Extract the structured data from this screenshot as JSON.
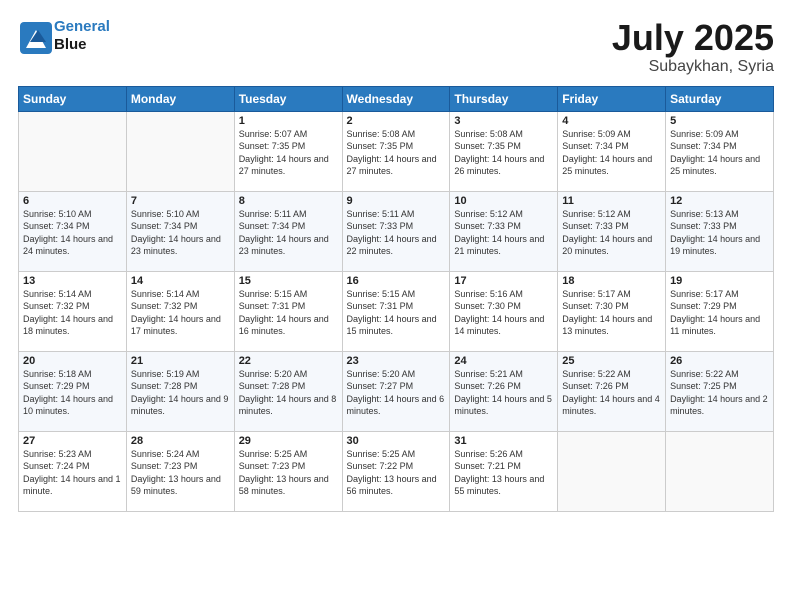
{
  "logo": {
    "line1": "General",
    "line2": "Blue"
  },
  "title": "July 2025",
  "subtitle": "Subaykhan, Syria",
  "header_days": [
    "Sunday",
    "Monday",
    "Tuesday",
    "Wednesday",
    "Thursday",
    "Friday",
    "Saturday"
  ],
  "weeks": [
    [
      {
        "day": "",
        "info": ""
      },
      {
        "day": "",
        "info": ""
      },
      {
        "day": "1",
        "sunrise": "5:07 AM",
        "sunset": "7:35 PM",
        "daylight": "14 hours and 27 minutes."
      },
      {
        "day": "2",
        "sunrise": "5:08 AM",
        "sunset": "7:35 PM",
        "daylight": "14 hours and 27 minutes."
      },
      {
        "day": "3",
        "sunrise": "5:08 AM",
        "sunset": "7:35 PM",
        "daylight": "14 hours and 26 minutes."
      },
      {
        "day": "4",
        "sunrise": "5:09 AM",
        "sunset": "7:34 PM",
        "daylight": "14 hours and 25 minutes."
      },
      {
        "day": "5",
        "sunrise": "5:09 AM",
        "sunset": "7:34 PM",
        "daylight": "14 hours and 25 minutes."
      }
    ],
    [
      {
        "day": "6",
        "sunrise": "5:10 AM",
        "sunset": "7:34 PM",
        "daylight": "14 hours and 24 minutes."
      },
      {
        "day": "7",
        "sunrise": "5:10 AM",
        "sunset": "7:34 PM",
        "daylight": "14 hours and 23 minutes."
      },
      {
        "day": "8",
        "sunrise": "5:11 AM",
        "sunset": "7:34 PM",
        "daylight": "14 hours and 23 minutes."
      },
      {
        "day": "9",
        "sunrise": "5:11 AM",
        "sunset": "7:33 PM",
        "daylight": "14 hours and 22 minutes."
      },
      {
        "day": "10",
        "sunrise": "5:12 AM",
        "sunset": "7:33 PM",
        "daylight": "14 hours and 21 minutes."
      },
      {
        "day": "11",
        "sunrise": "5:12 AM",
        "sunset": "7:33 PM",
        "daylight": "14 hours and 20 minutes."
      },
      {
        "day": "12",
        "sunrise": "5:13 AM",
        "sunset": "7:33 PM",
        "daylight": "14 hours and 19 minutes."
      }
    ],
    [
      {
        "day": "13",
        "sunrise": "5:14 AM",
        "sunset": "7:32 PM",
        "daylight": "14 hours and 18 minutes."
      },
      {
        "day": "14",
        "sunrise": "5:14 AM",
        "sunset": "7:32 PM",
        "daylight": "14 hours and 17 minutes."
      },
      {
        "day": "15",
        "sunrise": "5:15 AM",
        "sunset": "7:31 PM",
        "daylight": "14 hours and 16 minutes."
      },
      {
        "day": "16",
        "sunrise": "5:15 AM",
        "sunset": "7:31 PM",
        "daylight": "14 hours and 15 minutes."
      },
      {
        "day": "17",
        "sunrise": "5:16 AM",
        "sunset": "7:30 PM",
        "daylight": "14 hours and 14 minutes."
      },
      {
        "day": "18",
        "sunrise": "5:17 AM",
        "sunset": "7:30 PM",
        "daylight": "14 hours and 13 minutes."
      },
      {
        "day": "19",
        "sunrise": "5:17 AM",
        "sunset": "7:29 PM",
        "daylight": "14 hours and 11 minutes."
      }
    ],
    [
      {
        "day": "20",
        "sunrise": "5:18 AM",
        "sunset": "7:29 PM",
        "daylight": "14 hours and 10 minutes."
      },
      {
        "day": "21",
        "sunrise": "5:19 AM",
        "sunset": "7:28 PM",
        "daylight": "14 hours and 9 minutes."
      },
      {
        "day": "22",
        "sunrise": "5:20 AM",
        "sunset": "7:28 PM",
        "daylight": "14 hours and 8 minutes."
      },
      {
        "day": "23",
        "sunrise": "5:20 AM",
        "sunset": "7:27 PM",
        "daylight": "14 hours and 6 minutes."
      },
      {
        "day": "24",
        "sunrise": "5:21 AM",
        "sunset": "7:26 PM",
        "daylight": "14 hours and 5 minutes."
      },
      {
        "day": "25",
        "sunrise": "5:22 AM",
        "sunset": "7:26 PM",
        "daylight": "14 hours and 4 minutes."
      },
      {
        "day": "26",
        "sunrise": "5:22 AM",
        "sunset": "7:25 PM",
        "daylight": "14 hours and 2 minutes."
      }
    ],
    [
      {
        "day": "27",
        "sunrise": "5:23 AM",
        "sunset": "7:24 PM",
        "daylight": "14 hours and 1 minute."
      },
      {
        "day": "28",
        "sunrise": "5:24 AM",
        "sunset": "7:23 PM",
        "daylight": "13 hours and 59 minutes."
      },
      {
        "day": "29",
        "sunrise": "5:25 AM",
        "sunset": "7:23 PM",
        "daylight": "13 hours and 58 minutes."
      },
      {
        "day": "30",
        "sunrise": "5:25 AM",
        "sunset": "7:22 PM",
        "daylight": "13 hours and 56 minutes."
      },
      {
        "day": "31",
        "sunrise": "5:26 AM",
        "sunset": "7:21 PM",
        "daylight": "13 hours and 55 minutes."
      },
      {
        "day": "",
        "info": ""
      },
      {
        "day": "",
        "info": ""
      }
    ]
  ]
}
